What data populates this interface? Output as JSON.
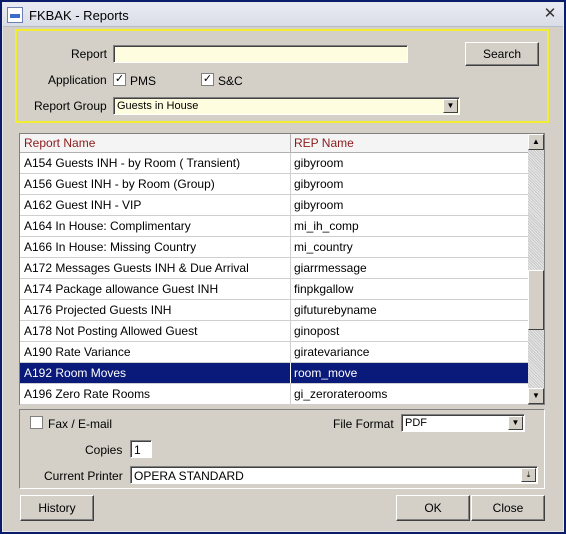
{
  "window": {
    "title": "FKBAK - Reports",
    "icon": "app-icon",
    "close_glyph": "✕"
  },
  "criteria": {
    "report_label": "Report",
    "report_value": "",
    "search_label": "Search",
    "application_label": "Application",
    "app_pms_label": "PMS",
    "app_pms_checked": true,
    "app_sc_label": "S&C",
    "app_sc_checked": true,
    "report_group_label": "Report Group",
    "report_group_value": "Guests in House",
    "border_color": "#f2ee2f"
  },
  "grid": {
    "columns": [
      "Report Name",
      "REP Name"
    ],
    "rows": [
      {
        "name": "A154 Guests INH - by Room ( Transient)",
        "rep": "gibyroom",
        "selected": false
      },
      {
        "name": "A156 Guest INH - by Room (Group)",
        "rep": "gibyroom",
        "selected": false
      },
      {
        "name": "A162 Guest INH - VIP",
        "rep": "gibyroom",
        "selected": false
      },
      {
        "name": "A164 In House: Complimentary",
        "rep": "mi_ih_comp",
        "selected": false
      },
      {
        "name": "A166 In House: Missing Country",
        "rep": "mi_country",
        "selected": false
      },
      {
        "name": "A172 Messages Guests INH & Due Arrival",
        "rep": "giarrmessage",
        "selected": false
      },
      {
        "name": "A174 Package allowance Guest INH",
        "rep": "finpkgallow",
        "selected": false
      },
      {
        "name": "A176 Projected Guests INH",
        "rep": "gifuturebyname",
        "selected": false
      },
      {
        "name": "A178 Not Posting Allowed Guest",
        "rep": "ginopost",
        "selected": false
      },
      {
        "name": "A190 Rate Variance",
        "rep": "giratevariance",
        "selected": false
      },
      {
        "name": "A192 Room Moves",
        "rep": "room_move",
        "selected": true
      },
      {
        "name": "A196 Zero Rate Rooms",
        "rep": "gi_zeroraterooms",
        "selected": false
      }
    ],
    "header_color": "#8b1a1a",
    "selected_color": "#0a1a7a"
  },
  "options": {
    "fax_label": "Fax / E-mail",
    "fax_checked": false,
    "file_format_label": "File Format",
    "file_format_value": "PDF",
    "copies_label": "Copies",
    "copies_value": "1",
    "printer_label": "Current Printer",
    "printer_value": "OPERA STANDARD"
  },
  "buttons": {
    "history": "History",
    "ok": "OK",
    "close": "Close"
  }
}
